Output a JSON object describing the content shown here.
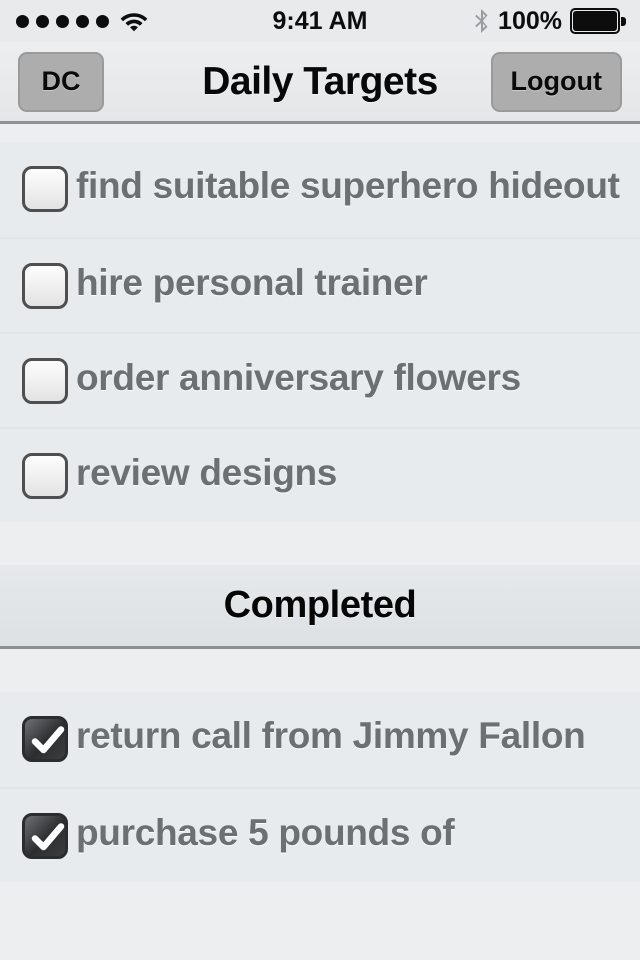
{
  "status_bar": {
    "signal_dots": 5,
    "wifi_icon": "wifi-icon",
    "time": "9:41 AM",
    "bluetooth_icon": "bluetooth-icon",
    "battery_percent": "100%",
    "battery_icon": "battery-full-icon"
  },
  "nav": {
    "left_button": "DC",
    "title": "Daily Targets",
    "right_button": "Logout"
  },
  "todo_section": {
    "items": [
      {
        "label": "find suitable superhero hideout",
        "checked": false
      },
      {
        "label": "hire personal trainer",
        "checked": false
      },
      {
        "label": "order anniversary flowers",
        "checked": false
      },
      {
        "label": "review designs",
        "checked": false
      }
    ]
  },
  "completed_section": {
    "header": "Completed",
    "items": [
      {
        "label": "return call from Jimmy Fallon",
        "checked": true
      },
      {
        "label": "purchase 5 pounds of",
        "checked": true
      }
    ]
  },
  "colors": {
    "screen_bg": "#eceef0",
    "row_bg": "#e7ebed",
    "row_text": "#6b7072",
    "nav_button": "#adadad",
    "separator": "#8e9194",
    "checked_box": "#2b2d2f"
  }
}
